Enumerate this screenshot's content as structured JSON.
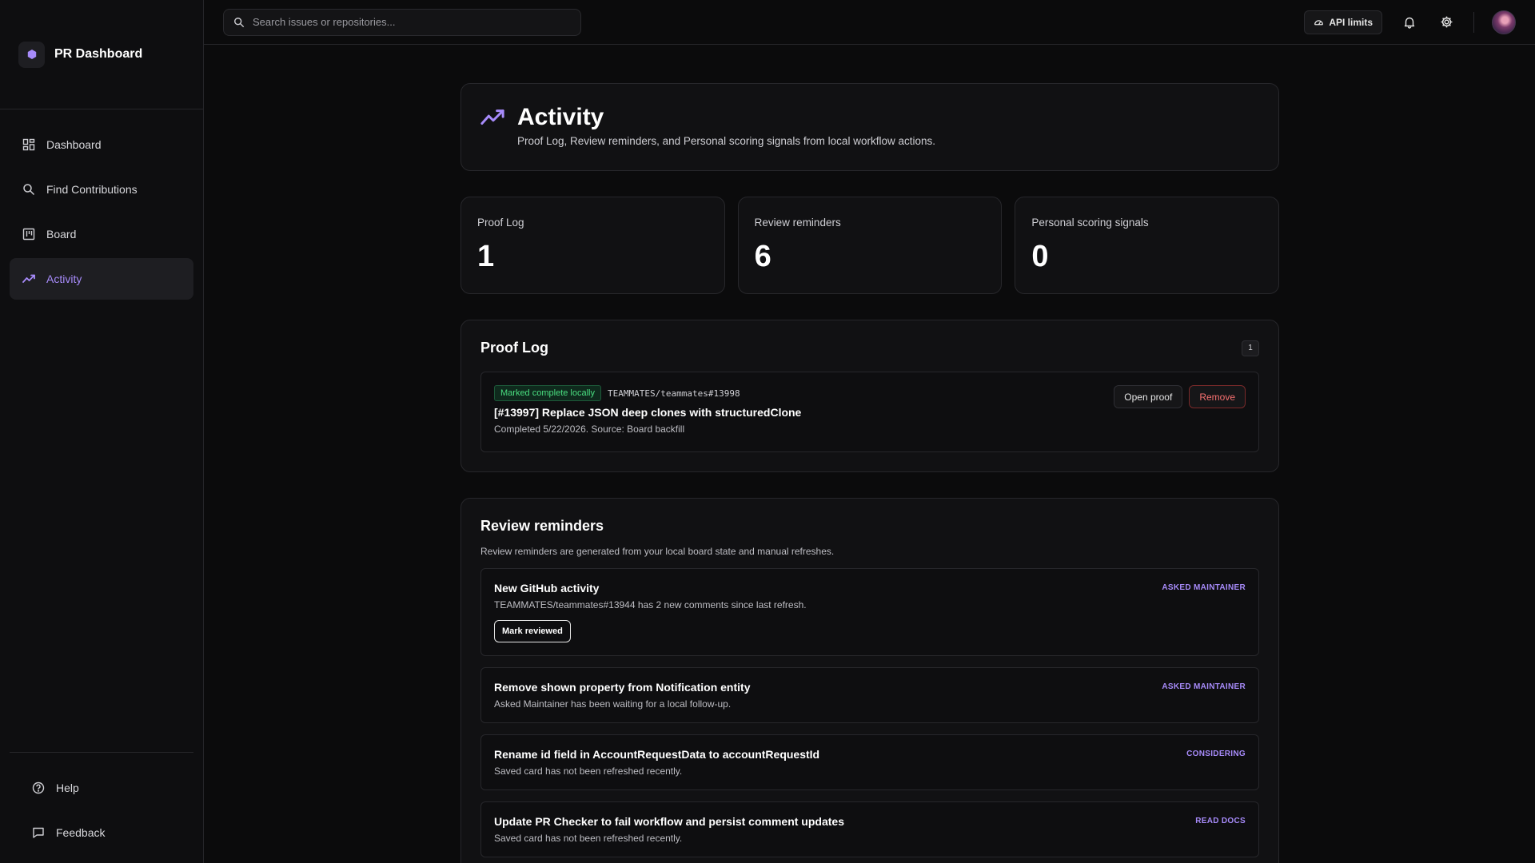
{
  "brand": {
    "title": "PR Dashboard"
  },
  "sidebar": {
    "items": [
      {
        "label": "Dashboard",
        "icon": "grid-icon"
      },
      {
        "label": "Find Contributions",
        "icon": "search-icon"
      },
      {
        "label": "Board",
        "icon": "board-icon"
      },
      {
        "label": "Activity",
        "icon": "activity-icon",
        "active": true
      }
    ],
    "bottom": [
      {
        "label": "Help",
        "icon": "help-icon"
      },
      {
        "label": "Feedback",
        "icon": "feedback-icon"
      }
    ]
  },
  "topbar": {
    "search_placeholder": "Search issues or repositories...",
    "api_limits_label": "API limits"
  },
  "header": {
    "title": "Activity",
    "subtitle": "Proof Log, Review reminders, and Personal scoring signals from local workflow actions."
  },
  "stats": [
    {
      "label": "Proof Log",
      "value": "1"
    },
    {
      "label": "Review reminders",
      "value": "6"
    },
    {
      "label": "Personal scoring signals",
      "value": "0"
    }
  ],
  "proof_log": {
    "title": "Proof Log",
    "count": "1",
    "entries": [
      {
        "status": "Marked complete locally",
        "ref": "TEAMMATES/teammates#13998",
        "title": "[#13997] Replace JSON deep clones with structuredClone",
        "meta": "Completed 5/22/2026. Source: Board backfill",
        "open_label": "Open proof",
        "remove_label": "Remove"
      }
    ]
  },
  "reminders": {
    "title": "Review reminders",
    "description": "Review reminders are generated from your local board state and manual refreshes.",
    "items": [
      {
        "title": "New GitHub activity",
        "sub": "TEAMMATES/teammates#13944 has 2 new comments since last refresh.",
        "tag": "ASKED MAINTAINER",
        "action": "Mark reviewed"
      },
      {
        "title": "Remove shown property from Notification entity",
        "sub": "Asked Maintainer has been waiting for a local follow-up.",
        "tag": "ASKED MAINTAINER"
      },
      {
        "title": "Rename id field in AccountRequestData to accountRequestId",
        "sub": "Saved card has not been refreshed recently.",
        "tag": "CONSIDERING"
      },
      {
        "title": "Update PR Checker to fail workflow and persist comment updates",
        "sub": "Saved card has not been refreshed recently.",
        "tag": "READ DOCS"
      }
    ]
  },
  "colors": {
    "accent": "#a78bfa",
    "success": "#4ade80",
    "danger": "#f87171"
  }
}
